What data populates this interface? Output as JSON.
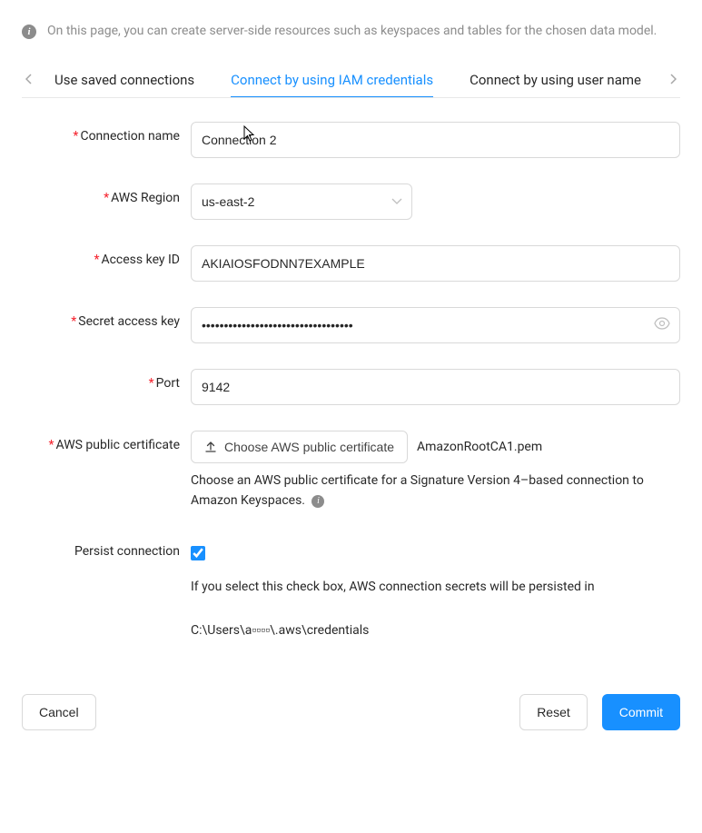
{
  "info": {
    "text": "On this page, you can create server-side resources such as keyspaces and tables for the chosen data model."
  },
  "tabs": {
    "items": [
      {
        "label": "Use saved connections"
      },
      {
        "label": "Connect by using IAM credentials"
      },
      {
        "label": "Connect by using user name"
      }
    ]
  },
  "form": {
    "connection_name": {
      "label": "Connection name",
      "value": "Connection 2"
    },
    "aws_region": {
      "label": "AWS Region",
      "value": "us-east-2"
    },
    "access_key_id": {
      "label": "Access key ID",
      "value": "AKIAIOSFODNN7EXAMPLE"
    },
    "secret_access_key": {
      "label": "Secret access key",
      "value": "••••••••••••••••••••••••••••••••••"
    },
    "port": {
      "label": "Port",
      "value": "9142"
    },
    "aws_public_cert": {
      "label": "AWS public certificate",
      "button": "Choose AWS public certificate",
      "filename": "AmazonRootCA1.pem",
      "help": "Choose an AWS public certificate for a Signature Version 4–based connection to Amazon Keyspaces."
    },
    "persist": {
      "label": "Persist connection",
      "checked": true,
      "help": "If you select this check box, AWS connection secrets will be persisted in",
      "path": "C:\\Users\\a▫▫▫▫\\.aws\\credentials"
    }
  },
  "footer": {
    "cancel": "Cancel",
    "reset": "Reset",
    "commit": "Commit"
  }
}
